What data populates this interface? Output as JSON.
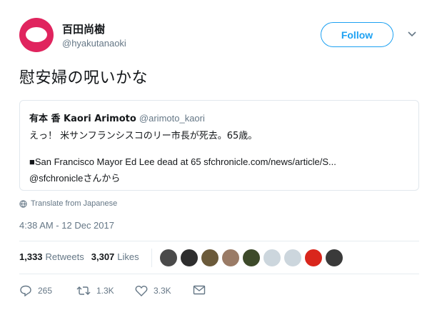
{
  "author": {
    "name": "百田尚樹",
    "handle": "@hyakutanaoki"
  },
  "follow_label": "Follow",
  "tweet_text": "慰安婦の呪いかな",
  "quoted": {
    "name": "有本 香 Kaori Arimoto",
    "handle": "@arimoto_kaori",
    "line1": "えっ！ 米サンフランシスコのリー市長が死去。65歳。",
    "line2": "■San Francisco Mayor Ed Lee dead at 65 sfchronicle.com/news/article/S...",
    "line3_handle": "@sfchronicle",
    "line3_suffix": "さんから"
  },
  "translate_label": "Translate from Japanese",
  "timestamp": "4:38 AM - 12 Dec 2017",
  "stats": {
    "retweets_count": "1,333",
    "retweets_label": "Retweets",
    "likes_count": "3,307",
    "likes_label": "Likes"
  },
  "likers": [
    {
      "name": "liker-avatar-1",
      "color": "#4a4a4a"
    },
    {
      "name": "liker-avatar-2",
      "color": "#2e2e2e"
    },
    {
      "name": "liker-avatar-3",
      "color": "#6b5a3a"
    },
    {
      "name": "liker-avatar-4",
      "color": "#9a7b66"
    },
    {
      "name": "liker-avatar-5",
      "color": "#3d4a2a"
    },
    {
      "name": "liker-avatar-6",
      "color": "#ccd6dd"
    },
    {
      "name": "liker-avatar-7",
      "color": "#ccd6dd"
    },
    {
      "name": "liker-avatar-8",
      "color": "#d9261c"
    },
    {
      "name": "liker-avatar-9",
      "color": "#3a3a3a"
    }
  ],
  "actions": {
    "reply_count": "265",
    "retweet_count": "1.3K",
    "like_count": "3.3K"
  },
  "colors": {
    "accent": "#1da1f2",
    "avatar": "#e0245e",
    "muted": "#657786"
  }
}
